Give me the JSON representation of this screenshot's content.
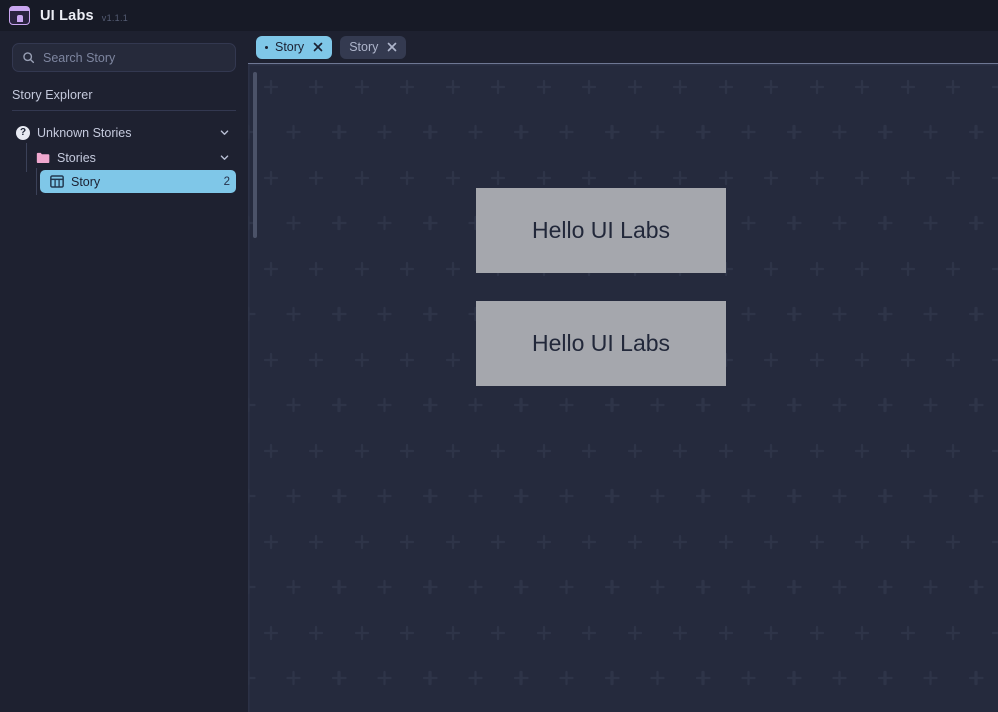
{
  "header": {
    "logo_icon": "app-window-person-icon",
    "title": "UI Labs",
    "version": "v1.1.1"
  },
  "sidebar": {
    "search": {
      "icon": "search-icon",
      "placeholder": "Search Story",
      "value": ""
    },
    "explorer_title": "Story Explorer",
    "tree": [
      {
        "label": "Unknown Stories",
        "icon": "question-circle-icon",
        "chevron": "chevron-down-icon",
        "level": 0
      },
      {
        "label": "Stories",
        "icon": "folder-icon",
        "chevron": "chevron-down-icon",
        "level": 1
      },
      {
        "label": "Story",
        "icon": "component-icon",
        "badge": "2",
        "level": 2,
        "selected": true
      }
    ]
  },
  "tabs": [
    {
      "label": "Story",
      "active": true,
      "dot": true,
      "close_icon": "close-icon"
    },
    {
      "label": "Story",
      "active": false,
      "dot": false,
      "close_icon": "close-icon"
    }
  ],
  "canvas": {
    "boxes": [
      {
        "text": "Hello UI Labs"
      },
      {
        "text": "Hello UI Labs"
      }
    ]
  },
  "colors": {
    "accent_blue": "#7fc7e8",
    "logo_purple": "#c9a6f0",
    "folder_pink": "#f0a8cf",
    "sidebar_bg": "#1e2130",
    "header_bg": "#171a26",
    "canvas_bg": "#252a3d",
    "box_gray": "#a5a7ad"
  }
}
